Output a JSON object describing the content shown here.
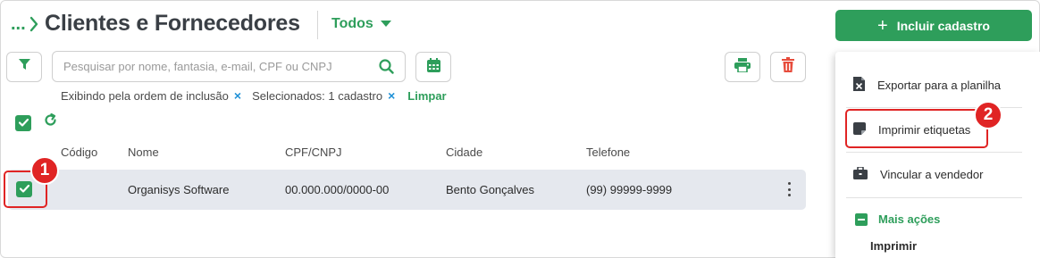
{
  "breadcrumb": {
    "ellipsis": "..."
  },
  "page_title": "Clientes e Fornecedores",
  "view_filter": {
    "selected": "Todos"
  },
  "include_button": {
    "label": "Incluir cadastro"
  },
  "search": {
    "placeholder": "Pesquisar por nome, fantasia, e-mail, CPF ou CNPJ",
    "value": ""
  },
  "chips": [
    {
      "label": "Exibindo pela ordem de inclusão",
      "remove": "×"
    },
    {
      "label": "Selecionados: 1 cadastro",
      "remove": "×"
    }
  ],
  "clear_label": "Limpar",
  "table": {
    "headers": [
      "Código",
      "Nome",
      "CPF/CNPJ",
      "Cidade",
      "Telefone"
    ],
    "rows": [
      {
        "codigo": "",
        "nome": "Organisys Software",
        "cpf_cnpj": "00.000.000/0000-00",
        "cidade": "Bento Gonçalves",
        "telefone": "(99) 99999-9999",
        "selected": true
      }
    ]
  },
  "dropdown": {
    "items": [
      {
        "label": "Exportar para a planilha",
        "icon": "excel-file-icon"
      },
      {
        "label": "Imprimir etiquetas",
        "icon": "label-tag-icon"
      },
      {
        "label": "Vincular a vendedor",
        "icon": "briefcase-icon"
      }
    ],
    "more_actions": "Mais ações",
    "more_actions_items": [
      "Imprimir"
    ]
  },
  "annotations": [
    {
      "number": "1",
      "target": "row-checkbox"
    },
    {
      "number": "2",
      "target": "menu-item-imprimir-etiquetas"
    }
  ],
  "colors": {
    "accent": "#2e9e5b",
    "danger": "#e74c3c",
    "annotation": "#e02424",
    "link": "#1e90d6",
    "row_highlight": "#e5e8ee"
  }
}
